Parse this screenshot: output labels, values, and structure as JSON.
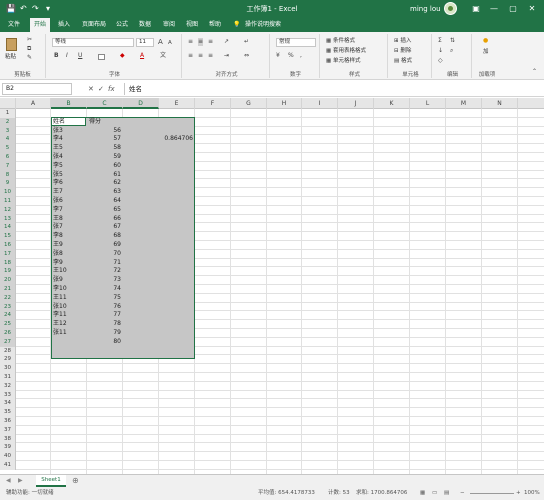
{
  "title_bar": {
    "title": "工作簿1 - Excel",
    "user": "ming lou",
    "save_icon": "💾",
    "undo_icon": "↶",
    "redo_icon": "↷",
    "customize_icon": "▾",
    "ribbon_options_icon": "▣",
    "minimize": "—",
    "restore": "▢",
    "close": "✕"
  },
  "menu": {
    "tabs": [
      "文件",
      "开始",
      "插入",
      "页面布局",
      "公式",
      "数据",
      "审阅",
      "视图",
      "帮助"
    ],
    "active_tab": "开始",
    "tell_me": "操作说明搜索",
    "lightbulb_icon": "💡"
  },
  "ribbon": {
    "paste": "粘贴",
    "clipboard": "剪贴板",
    "font_name": "等线",
    "font_size": "11",
    "font": "字体",
    "bold": "B",
    "italic": "I",
    "underline": "U",
    "grow_font": "A",
    "shrink_font": "A",
    "alignment": "对齐方式",
    "number_format": "常规",
    "percent": "%",
    "comma": ",",
    "number": "数字",
    "conditional_format": "条件格式",
    "format_as_table": "套用表格格式",
    "cell_styles": "单元格样式",
    "styles": "样式",
    "insert": "插入",
    "delete": "删除",
    "format": "格式",
    "cells": "单元格",
    "editing": "编辑",
    "addin": "加载项",
    "addin_button": "加"
  },
  "formula_bar": {
    "name_box": "B2",
    "fx": "fx",
    "cancel": "✕",
    "enter": "✓",
    "content": "姓名"
  },
  "columns": [
    "A",
    "B",
    "C",
    "D",
    "E",
    "F",
    "G",
    "H",
    "I",
    "J",
    "K",
    "L",
    "M",
    "N"
  ],
  "rows": [
    "1",
    "2",
    "3",
    "4",
    "5",
    "6",
    "7",
    "8",
    "9",
    "10",
    "11",
    "12",
    "13",
    "14",
    "15",
    "16",
    "17",
    "18",
    "19",
    "20",
    "21",
    "22",
    "23",
    "24",
    "25",
    "26",
    "27",
    "28",
    "29",
    "30",
    "31",
    "32",
    "33",
    "34",
    "35",
    "36",
    "37",
    "38",
    "39",
    "40",
    "41"
  ],
  "table": {
    "headers": [
      "姓名",
      "得分"
    ],
    "names": [
      "张3",
      "李4",
      "王5",
      "张4",
      "李5",
      "张5",
      "李6",
      "王7",
      "张6",
      "李7",
      "王8",
      "张7",
      "李8",
      "王9",
      "张8",
      "李9",
      "王10",
      "张9",
      "李10",
      "王11",
      "张10",
      "李11",
      "王12",
      "张11"
    ],
    "scores": [
      "56",
      "57",
      "58",
      "59",
      "60",
      "61",
      "62",
      "63",
      "64",
      "65",
      "66",
      "67",
      "68",
      "69",
      "70",
      "71",
      "72",
      "73",
      "74",
      "75",
      "76",
      "77",
      "78",
      "79",
      "80"
    ]
  },
  "cell_e4": "0.864706",
  "sheet_tab": "Sheet1",
  "add_sheet": "⊕",
  "status": {
    "ready": "辅助功能: 一切就绪",
    "average": "平均值: 654.4178733",
    "count": "计数: 53",
    "sum": "求和: 1700.864706",
    "zoom": "100%"
  }
}
